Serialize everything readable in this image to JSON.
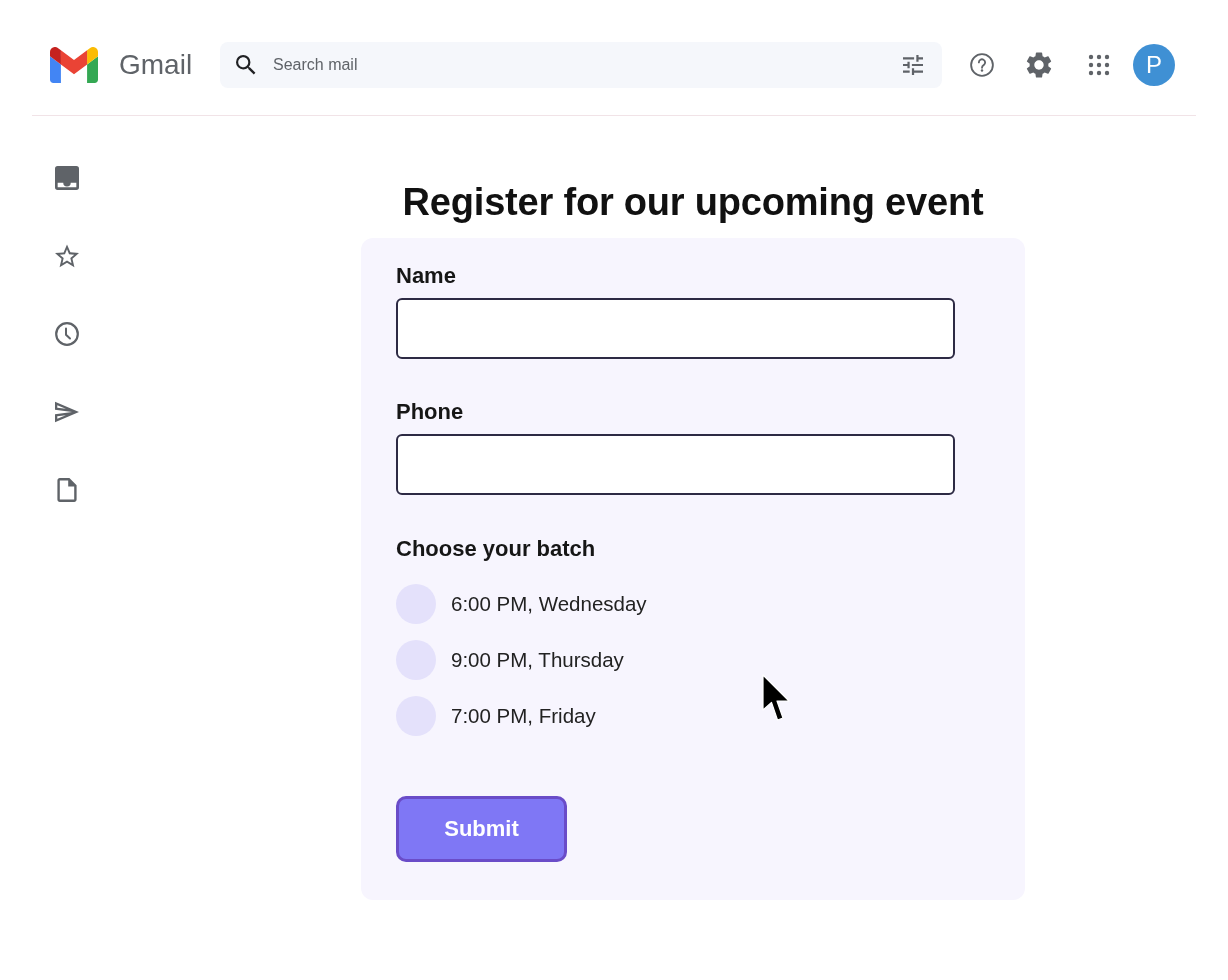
{
  "header": {
    "brand": "Gmail",
    "search": {
      "placeholder": "Search mail"
    },
    "avatar": {
      "initial": "P"
    }
  },
  "form": {
    "title": "Register for our upcoming event",
    "fields": [
      {
        "label": "Name"
      },
      {
        "label": "Phone"
      }
    ],
    "batch": {
      "label": "Choose your batch",
      "options": [
        {
          "label": "6:00 PM, Wednesday",
          "selected": false
        },
        {
          "label": "9:00 PM, Thursday",
          "selected": false
        },
        {
          "label": "7:00 PM, Friday",
          "selected": false
        }
      ]
    },
    "submit": "Submit"
  }
}
